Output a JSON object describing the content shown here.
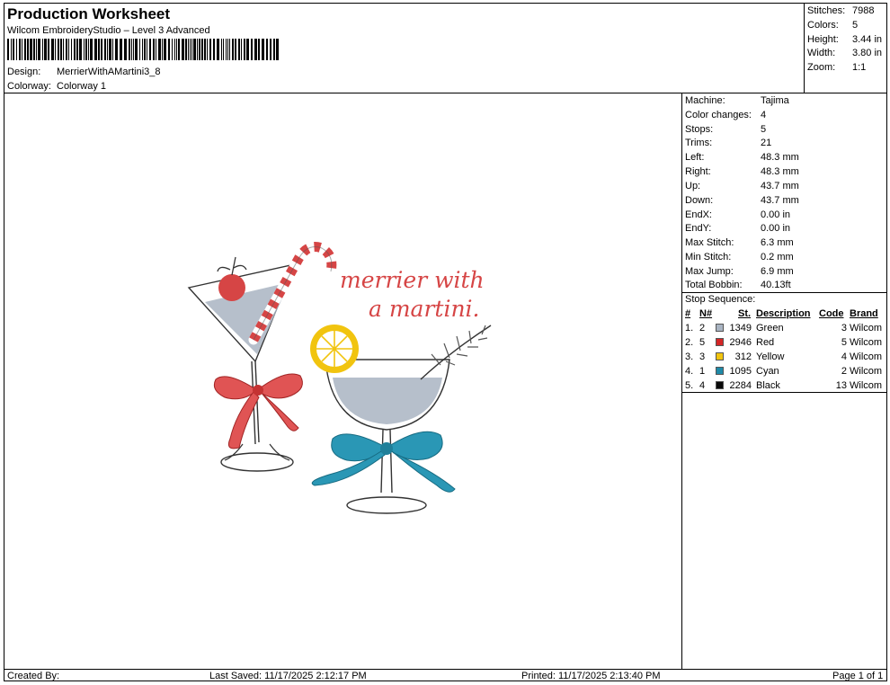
{
  "header": {
    "title": "Production Worksheet",
    "subtitle": "Wilcom EmbroideryStudio – Level 3 Advanced",
    "design_label": "Design:",
    "design_value": "MerrierWithAMartini3_8",
    "colorway_label": "Colorway:",
    "colorway_value": "Colorway 1"
  },
  "stats": {
    "stitches_label": "Stitches:",
    "stitches": "7988",
    "colors_label": "Colors:",
    "colors": "5",
    "height_label": "Height:",
    "height": "3.44 in",
    "width_label": "Width:",
    "width": "3.80 in",
    "zoom_label": "Zoom:",
    "zoom": "1:1"
  },
  "specs": [
    {
      "label": "Machine:",
      "value": "Tajima"
    },
    {
      "label": "Color changes:",
      "value": "4"
    },
    {
      "label": "Stops:",
      "value": "5"
    },
    {
      "label": "Trims:",
      "value": "21"
    },
    {
      "label": "Left:",
      "value": "48.3 mm"
    },
    {
      "label": "Right:",
      "value": "48.3 mm"
    },
    {
      "label": "Up:",
      "value": "43.7 mm"
    },
    {
      "label": "Down:",
      "value": "43.7 mm"
    },
    {
      "label": "EndX:",
      "value": "0.00 in"
    },
    {
      "label": "EndY:",
      "value": "0.00 in"
    },
    {
      "label": "Max Stitch:",
      "value": "6.3 mm"
    },
    {
      "label": "Min Stitch:",
      "value": "0.2 mm"
    },
    {
      "label": "Max Jump:",
      "value": "6.9 mm"
    },
    {
      "label": "Total Bobbin:",
      "value": "40.13ft"
    }
  ],
  "stop_sequence": {
    "title": "Stop Sequence:",
    "columns": {
      "num": "#",
      "n": "N#",
      "st": "St.",
      "description": "Description",
      "code": "Code",
      "brand": "Brand"
    },
    "rows": [
      {
        "num": "1.",
        "n": "2",
        "color": "#a9b4c2",
        "st": "1349",
        "description": "Green",
        "code": "3",
        "brand": "Wilcom"
      },
      {
        "num": "2.",
        "n": "5",
        "color": "#d42626",
        "st": "2946",
        "description": "Red",
        "code": "5",
        "brand": "Wilcom"
      },
      {
        "num": "3.",
        "n": "3",
        "color": "#f1c40f",
        "st": "312",
        "description": "Yellow",
        "code": "4",
        "brand": "Wilcom"
      },
      {
        "num": "4.",
        "n": "1",
        "color": "#1f8aa8",
        "st": "1095",
        "description": "Cyan",
        "code": "2",
        "brand": "Wilcom"
      },
      {
        "num": "5.",
        "n": "4",
        "color": "#0a0a0a",
        "st": "2284",
        "description": "Black",
        "code": "13",
        "brand": "Wilcom"
      }
    ]
  },
  "design_text": {
    "line1": "merrier with",
    "line2": "a martini."
  },
  "footer": {
    "created_by": "Created By:",
    "last_saved": "Last Saved: 11/17/2025 2:12:17 PM",
    "printed": "Printed: 11/17/2025 2:13:40 PM",
    "page": "Page 1 of 1"
  }
}
